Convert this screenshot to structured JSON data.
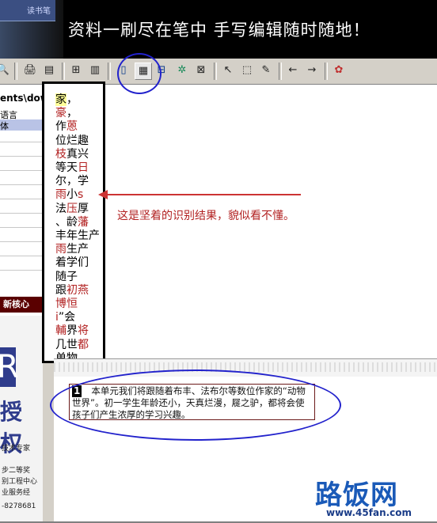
{
  "banner": {
    "old_window_title": "读书笔",
    "text": "资料一刷尽在笔中    手写编辑随时随地！"
  },
  "toolbar": {
    "icons": [
      "zoom-icon",
      "print-icon",
      "printer-icon",
      "layout-icon",
      "split-icon",
      "vertical-text-icon",
      "horizontal-text-icon",
      "table-icon",
      "sparkle-icon",
      "delete-block-icon",
      "pointer-icon",
      "select-region-icon",
      "pen-icon",
      "arrow-left-icon",
      "arrow-right-icon",
      "colors-icon"
    ],
    "selected": "horizontal-text-icon"
  },
  "left_panel": {
    "path": "ents\\dow",
    "language_label": "语言",
    "selected_item": "体",
    "news_tab": "新核心",
    "ad_big_letter": "R",
    "ad_big_text": "授权",
    "ad_lines": [
      "技术专家",
      "步二等奖",
      "别工程中心",
      "业服务经",
      "-8278681"
    ]
  },
  "recognition": {
    "lines": [
      [
        {
          "t": "家",
          "c": "n",
          "h": true
        },
        {
          "t": "，",
          "c": "n"
        }
      ],
      [
        {
          "t": "豪",
          "c": "r"
        },
        {
          "t": "，",
          "c": "n"
        }
      ],
      [
        {
          "t": "作",
          "c": "n"
        },
        {
          "t": "蒽",
          "c": "r"
        }
      ],
      [
        {
          "t": "位烂趣",
          "c": "n"
        }
      ],
      [
        {
          "t": "枝",
          "c": "r"
        },
        {
          "t": "真兴",
          "c": "n"
        }
      ],
      [
        {
          "t": "等天",
          "c": "n"
        },
        {
          "t": "日",
          "c": "r"
        }
      ],
      [
        {
          "t": "尔，学",
          "c": "n"
        }
      ],
      [
        {
          "t": "雨",
          "c": "r"
        },
        {
          "t": "小",
          "c": "n"
        },
        {
          "t": "s",
          "c": "r"
        }
      ],
      [
        {
          "t": "法",
          "c": "n"
        },
        {
          "t": "压",
          "c": "r"
        },
        {
          "t": "厚",
          "c": "n"
        }
      ],
      [
        {
          "t": "、龄",
          "c": "n"
        },
        {
          "t": "藩",
          "c": "r"
        }
      ],
      [
        {
          "t": "丰年生产",
          "c": "n"
        }
      ],
      [
        {
          "t": "雨",
          "c": "r"
        },
        {
          "t": "生产",
          "c": "n"
        }
      ],
      [
        {
          "t": "着学们",
          "c": "n"
        }
      ],
      [
        {
          "t": "随子",
          "c": "n"
        }
      ],
      [
        {
          "t": "跟",
          "c": "n"
        },
        {
          "t": "初燕",
          "c": "r"
        }
      ],
      [
        {
          "t": "博恒",
          "c": "r"
        }
      ],
      [
        {
          "t": "i",
          "c": "r"
        },
        {
          "t": "”会",
          "c": "n"
        }
      ],
      [
        {
          "t": "輔",
          "c": "r"
        },
        {
          "t": "界",
          "c": "n"
        },
        {
          "t": "将",
          "c": "r"
        }
      ],
      [
        {
          "t": "几世",
          "c": "n"
        },
        {
          "t": "都",
          "c": "r"
        }
      ],
      [
        {
          "t": "单物，",
          "c": "n"
        }
      ]
    ]
  },
  "annotation": "这是坚着的识别结果，貌似看不懂。",
  "result_paragraph": {
    "number": "1",
    "text": "本单元我们将跟随着布丰、法布尔等数位作家的“动物世界”。初一学生年龄还小，天真烂漫，屣之驴，都将会使孩子们产生浓厚的学习兴趣。"
  },
  "watermark": {
    "name": "路饭网",
    "url": "www.45fan.com"
  },
  "colors": {
    "annotation": "#b22222",
    "ellipse": "#2222cc",
    "watermark": "#1a5ab8"
  }
}
